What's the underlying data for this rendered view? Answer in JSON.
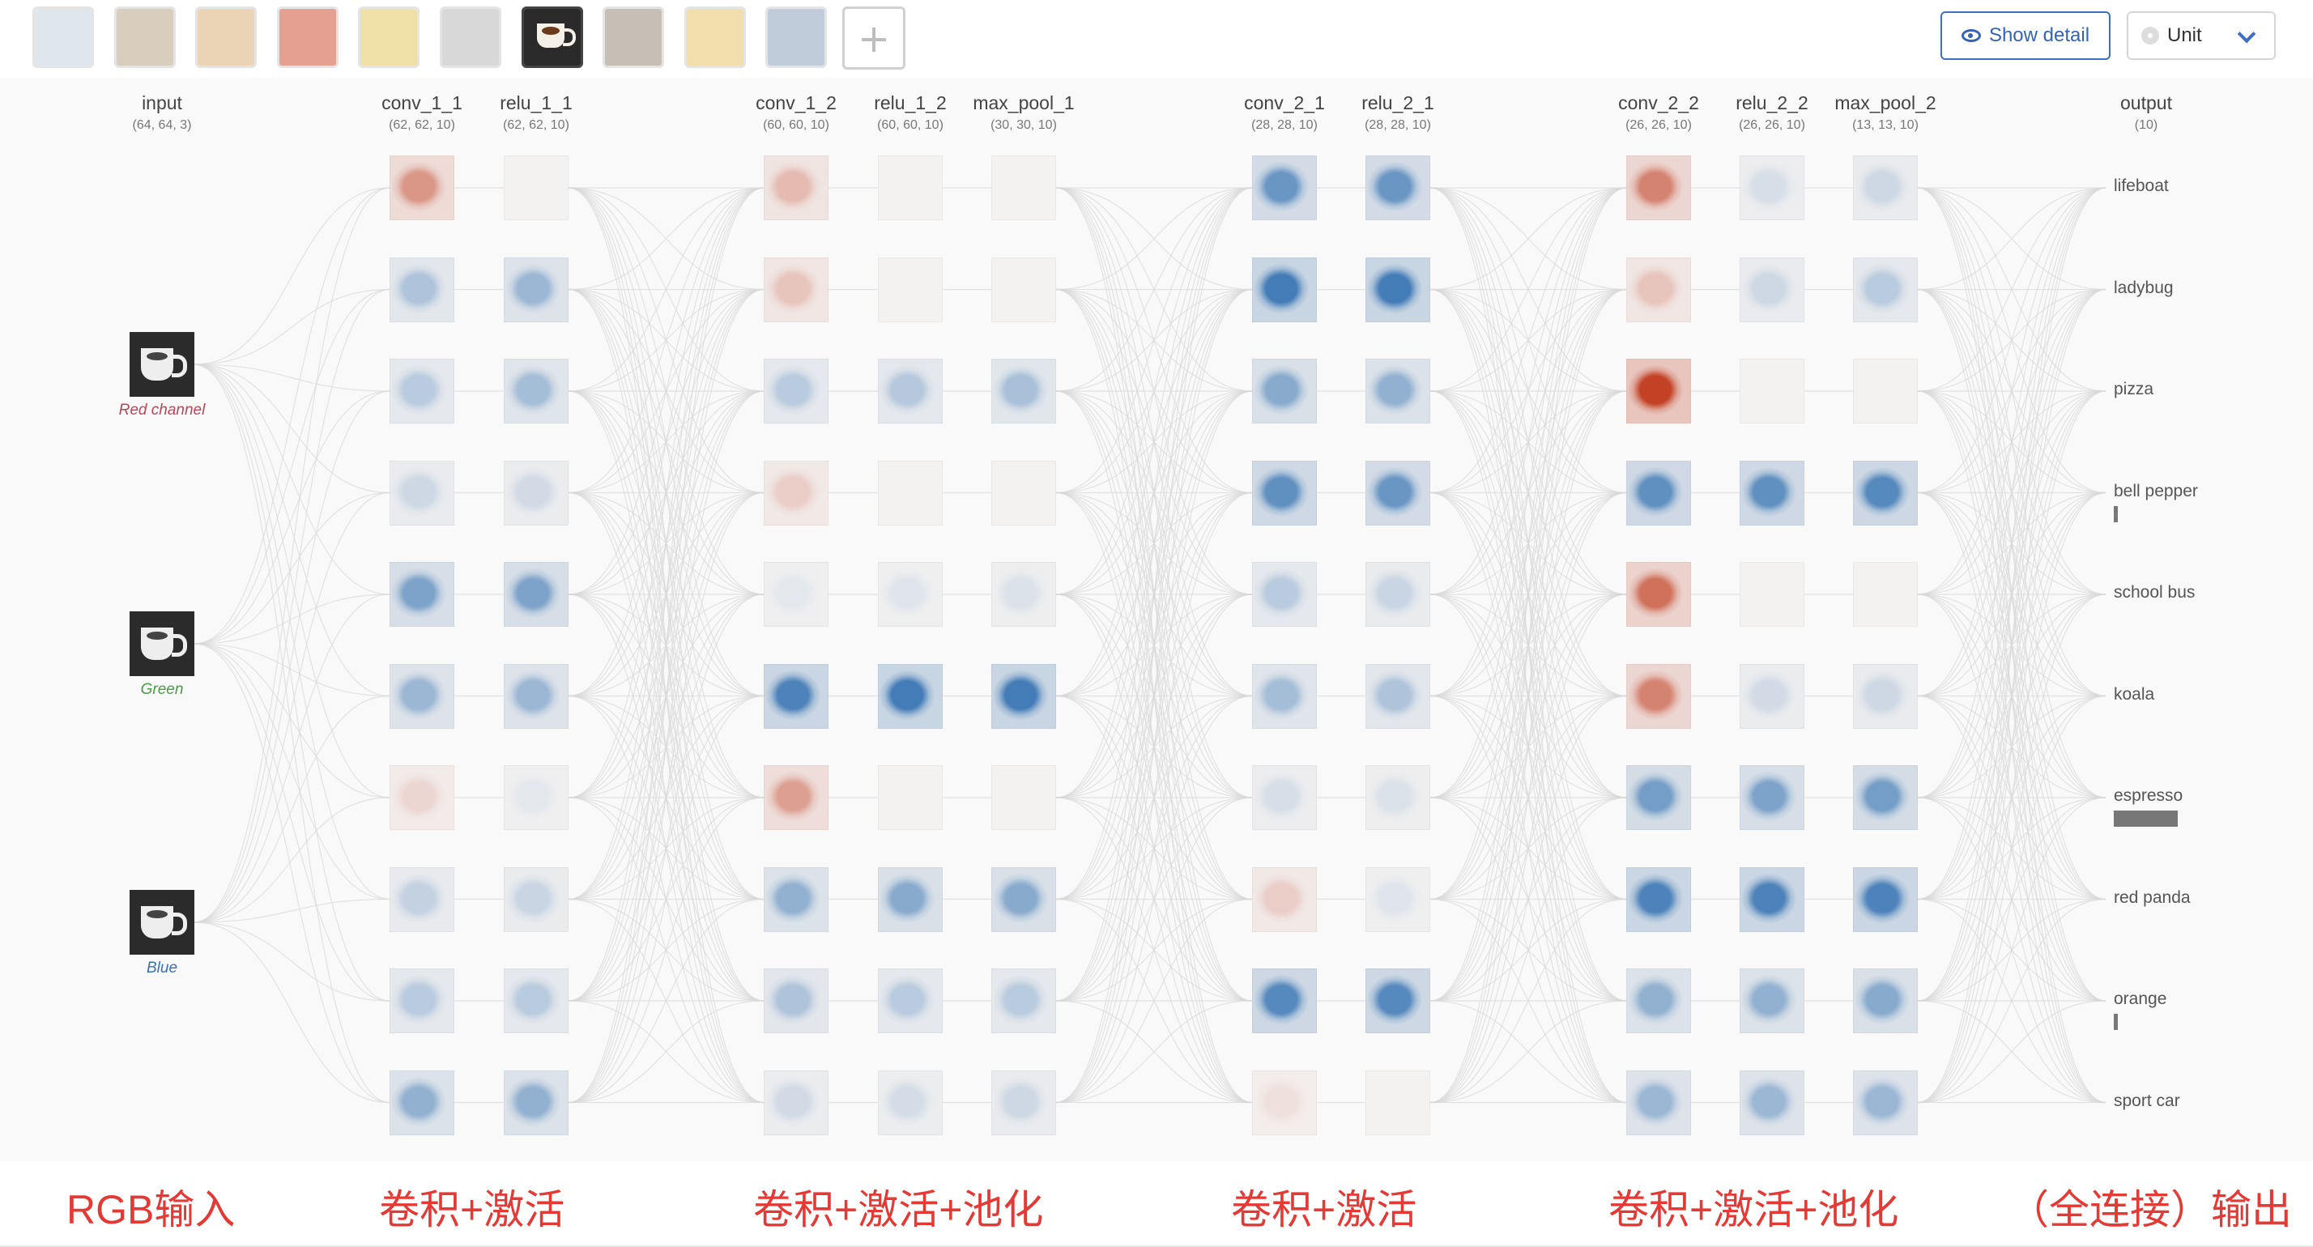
{
  "toolbar": {
    "thumbnails": [
      {
        "name": "lifeboat"
      },
      {
        "name": "ladybug"
      },
      {
        "name": "pizza"
      },
      {
        "name": "bell pepper"
      },
      {
        "name": "school bus"
      },
      {
        "name": "koala"
      },
      {
        "name": "espresso",
        "selected": true
      },
      {
        "name": "red panda"
      },
      {
        "name": "orange"
      },
      {
        "name": "sport car"
      }
    ],
    "show_detail_label": "Show detail",
    "unit_select_value": "Unit",
    "icons": {
      "add": "plus-icon",
      "show_detail": "eye-icon",
      "unit": "palette-icon",
      "dropdown": "chevron-down-icon"
    }
  },
  "layers": [
    {
      "id": "input",
      "title": "input",
      "dims": "(64, 64, 3)",
      "kind": "input"
    },
    {
      "id": "conv_1_1",
      "title": "conv_1_1",
      "dims": "(62, 62, 10)",
      "kind": "conv"
    },
    {
      "id": "relu_1_1",
      "title": "relu_1_1",
      "dims": "(62, 62, 10)",
      "kind": "relu"
    },
    {
      "id": "conv_1_2",
      "title": "conv_1_2",
      "dims": "(60, 60, 10)",
      "kind": "conv"
    },
    {
      "id": "relu_1_2",
      "title": "relu_1_2",
      "dims": "(60, 60, 10)",
      "kind": "relu"
    },
    {
      "id": "max_pool_1",
      "title": "max_pool_1",
      "dims": "(30, 30, 10)",
      "kind": "pool"
    },
    {
      "id": "conv_2_1",
      "title": "conv_2_1",
      "dims": "(28, 28, 10)",
      "kind": "conv"
    },
    {
      "id": "relu_2_1",
      "title": "relu_2_1",
      "dims": "(28, 28, 10)",
      "kind": "relu"
    },
    {
      "id": "conv_2_2",
      "title": "conv_2_2",
      "dims": "(26, 26, 10)",
      "kind": "conv"
    },
    {
      "id": "relu_2_2",
      "title": "relu_2_2",
      "dims": "(26, 26, 10)",
      "kind": "relu"
    },
    {
      "id": "max_pool_2",
      "title": "max_pool_2",
      "dims": "(13, 13, 10)",
      "kind": "pool"
    },
    {
      "id": "output",
      "title": "output",
      "dims": "(10)",
      "kind": "output"
    }
  ],
  "input_channels": [
    {
      "label": "Red channel",
      "color": "#b5485a"
    },
    {
      "label": "Green",
      "color": "#4a9a4a"
    },
    {
      "label": "Blue",
      "color": "#3a6fb5"
    }
  ],
  "activation_colors": {
    "positive": "#2f6fb0",
    "negative": "#c0391b",
    "neutral": "#f4f2f1"
  },
  "activations": {
    "conv_1_1": [
      -0.5,
      0.35,
      0.3,
      0.2,
      0.6,
      0.45,
      -0.15,
      0.25,
      0.3,
      0.5
    ],
    "relu_1_1": [
      0.0,
      0.45,
      0.4,
      0.18,
      0.6,
      0.45,
      0.08,
      0.22,
      0.3,
      0.5
    ],
    "conv_1_2": [
      -0.3,
      -0.25,
      0.3,
      -0.2,
      0.08,
      0.85,
      -0.45,
      0.5,
      0.35,
      0.18
    ],
    "relu_1_2": [
      0.0,
      0.0,
      0.32,
      0.0,
      0.1,
      0.9,
      0.0,
      0.55,
      0.3,
      0.16
    ],
    "max_pool_1": [
      0.0,
      0.0,
      0.38,
      0.0,
      0.12,
      0.9,
      0.0,
      0.55,
      0.3,
      0.2
    ],
    "conv_2_1": [
      0.7,
      0.9,
      0.55,
      0.75,
      0.3,
      0.4,
      0.15,
      -0.2,
      0.8,
      -0.1
    ],
    "relu_2_1": [
      0.7,
      0.9,
      0.5,
      0.7,
      0.22,
      0.35,
      0.12,
      0.1,
      0.8,
      0.0
    ],
    "conv_2_2": [
      -0.6,
      -0.25,
      -0.95,
      0.75,
      -0.7,
      -0.6,
      0.65,
      0.85,
      0.5,
      0.45
    ],
    "relu_2_2": [
      0.15,
      0.2,
      0.0,
      0.75,
      0.0,
      0.18,
      0.6,
      0.85,
      0.5,
      0.45
    ],
    "max_pool_2": [
      0.2,
      0.3,
      0.0,
      0.8,
      0.0,
      0.2,
      0.65,
      0.85,
      0.55,
      0.45
    ]
  },
  "outputs": [
    {
      "label": "lifeboat",
      "prob": 0.0
    },
    {
      "label": "ladybug",
      "prob": 0.0
    },
    {
      "label": "pizza",
      "prob": 0.0
    },
    {
      "label": "bell pepper",
      "prob": 0.05
    },
    {
      "label": "school bus",
      "prob": 0.0
    },
    {
      "label": "koala",
      "prob": 0.0
    },
    {
      "label": "espresso",
      "prob": 0.9
    },
    {
      "label": "red panda",
      "prob": 0.0
    },
    {
      "label": "orange",
      "prob": 0.05
    },
    {
      "label": "sport car",
      "prob": 0.0
    }
  ],
  "stage_labels": [
    "RGB输入",
    "卷积+激活",
    "卷积+激活+池化",
    "卷积+激活",
    "卷积+激活+池化",
    "（全连接）输出"
  ]
}
